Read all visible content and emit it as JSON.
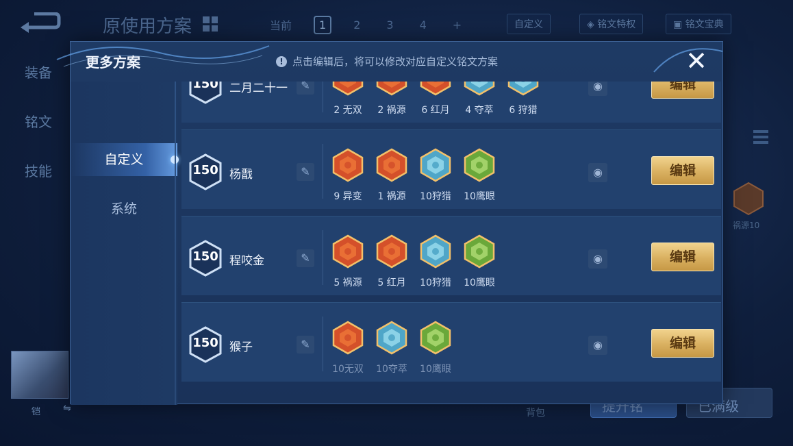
{
  "background": {
    "title": "原使用方案",
    "tabs": [
      "当前",
      "1",
      "2",
      "3",
      "4",
      "+"
    ],
    "custom_btn": "自定义",
    "privilege_btn": "铭文特权",
    "manual_btn": "铭文宝典",
    "side_items": [
      "装备",
      "铭文",
      "技能"
    ],
    "bag_label": "背包",
    "right_btn_1": "提升铭",
    "right_btn_2": "已满级",
    "hex_label": "祸源10",
    "avatar_label": "铠"
  },
  "modal": {
    "title": "更多方案",
    "tip": "点击编辑后，将可以修改对应自定义铭文方案",
    "close_symbol": "✕",
    "nav": [
      {
        "label": "自定义",
        "active": true
      },
      {
        "label": "系统",
        "active": false
      }
    ],
    "edit_label": "编辑",
    "rows": [
      {
        "level": "150",
        "name": "二月二十一",
        "gems": [
          {
            "label": "2 无双",
            "color": "red"
          },
          {
            "label": "2 祸源",
            "color": "red"
          },
          {
            "label": "6 红月",
            "color": "red"
          },
          {
            "label": "4 夺萃",
            "color": "blue"
          },
          {
            "label": "6 狩猎",
            "color": "blue"
          }
        ]
      },
      {
        "level": "150",
        "name": "杨戬",
        "gems": [
          {
            "label": "9 异变",
            "color": "red"
          },
          {
            "label": "1 祸源",
            "color": "red"
          },
          {
            "label": "10狩猎",
            "color": "blue"
          },
          {
            "label": "10鹰眼",
            "color": "green"
          }
        ]
      },
      {
        "level": "150",
        "name": "程咬金",
        "gems": [
          {
            "label": "5 祸源",
            "color": "red"
          },
          {
            "label": "5 红月",
            "color": "red"
          },
          {
            "label": "10狩猎",
            "color": "blue"
          },
          {
            "label": "10鹰眼",
            "color": "green"
          }
        ]
      },
      {
        "level": "150",
        "name": "猴子",
        "gems": [
          {
            "label": "10无双",
            "color": "red"
          },
          {
            "label": "10夺萃",
            "color": "blue"
          },
          {
            "label": "10鹰眼",
            "color": "green"
          }
        ]
      }
    ]
  },
  "colors": {
    "gem_red": "#d4502a",
    "gem_blue": "#5fb8d8",
    "gem_green": "#7fbf45",
    "edit_gold": "#d9b060"
  }
}
